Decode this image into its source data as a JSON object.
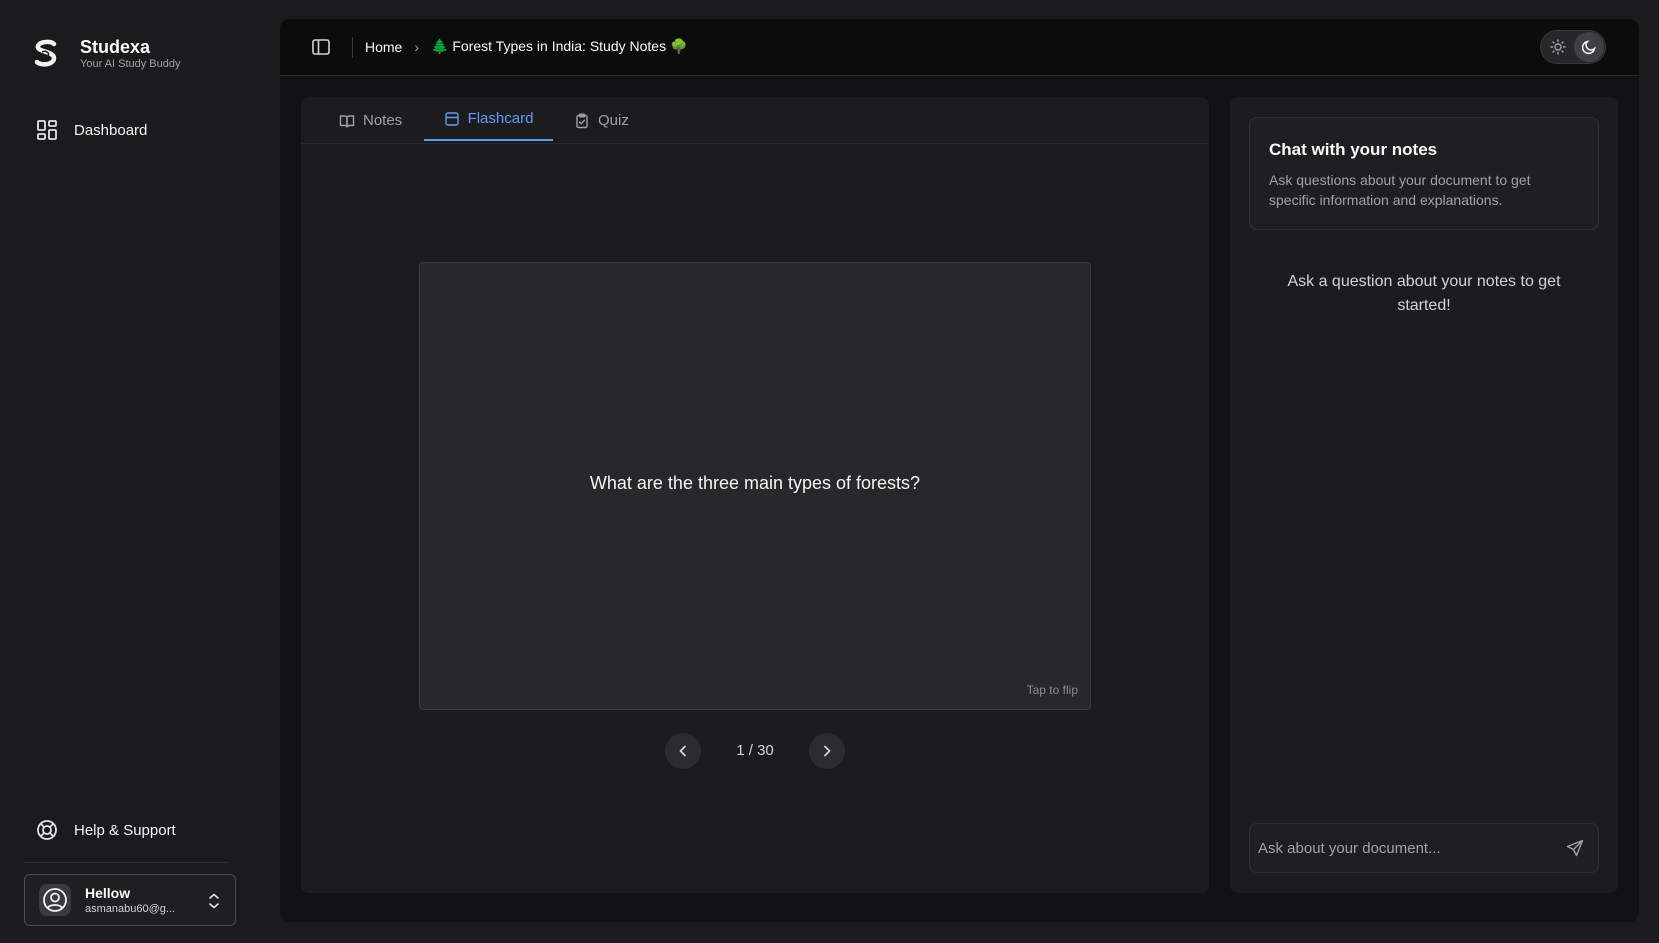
{
  "brand": {
    "name": "Studexa",
    "tagline": "Your AI Study Buddy"
  },
  "sidebar": {
    "items": [
      {
        "label": "Dashboard",
        "icon": "layout-grid-icon"
      }
    ],
    "footer_items": [
      {
        "label": "Help & Support",
        "icon": "lifebuoy-icon"
      }
    ]
  },
  "user": {
    "name": "Hellow",
    "email": "asmanabu60@g..."
  },
  "breadcrumb": {
    "home": "Home",
    "current": "🌲 Forest Types in India: Study Notes 🌳"
  },
  "theme": {
    "active": "dark"
  },
  "tabs": [
    {
      "label": "Notes",
      "icon": "book-open-icon"
    },
    {
      "label": "Flashcard",
      "icon": "card-icon",
      "active": true
    },
    {
      "label": "Quiz",
      "icon": "clipboard-check-icon"
    }
  ],
  "flashcard": {
    "question": "What are the three main types of forests?",
    "hint": "Tap to flip",
    "counter": "1 / 30"
  },
  "chat": {
    "title": "Chat with your notes",
    "description": "Ask questions about your document to get specific information and explanations.",
    "empty_state": "Ask a question about your notes to get started!",
    "input_placeholder": "Ask about your document..."
  },
  "colors": {
    "background": "#1b1b1d",
    "panel": "#1c1c1f",
    "accent": "#5b9df5",
    "text": "#f4f4f5",
    "muted": "#a1a1aa"
  }
}
